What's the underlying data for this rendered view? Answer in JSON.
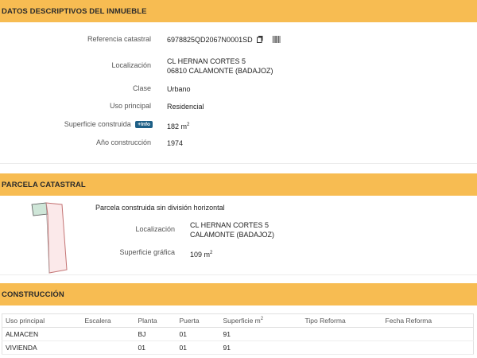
{
  "datos": {
    "title": "DATOS DESCRIPTIVOS DEL INMUEBLE",
    "ref_label": "Referencia catastral",
    "ref_value": "6978825QD2067N0001SD",
    "loc_label": "Localización",
    "loc_line1": "CL HERNAN CORTES 5",
    "loc_line2": "06810 CALAMONTE (BADAJOZ)",
    "clase_label": "Clase",
    "clase_value": "Urbano",
    "uso_label": "Uso principal",
    "uso_value": "Residencial",
    "sup_label": "Superficie construida",
    "info_badge": "+Info",
    "sup_value": "182 m",
    "sup_unit_exp": "2",
    "anio_label": "Año construcción",
    "anio_value": "1974"
  },
  "parcela": {
    "title": "PARCELA CATASTRAL",
    "desc": "Parcela construida sin división horizontal",
    "loc_label": "Localización",
    "loc_line1": "CL HERNAN CORTES 5",
    "loc_line2": "CALAMONTE (BADAJOZ)",
    "sup_label": "Superficie gráfica",
    "sup_value": "109 m",
    "sup_unit_exp": "2"
  },
  "construccion": {
    "title": "CONSTRUCCIÓN",
    "headers": [
      "Uso principal",
      "Escalera",
      "Planta",
      "Puerta",
      "Superficie m",
      "Tipo Reforma",
      "Fecha Reforma"
    ],
    "sup_header_exp": "2",
    "rows": [
      [
        "ALMACEN",
        "",
        "BJ",
        "01",
        "91",
        "",
        ""
      ],
      [
        "VIVIENDA",
        "",
        "01",
        "01",
        "91",
        "",
        ""
      ]
    ]
  },
  "colors": {
    "header_bg": "#f7bc52",
    "badge_bg": "#1d5f86",
    "parcel_fill": "#fbe9ea",
    "parcel_green": "#cfe6d8"
  },
  "icons": [
    "copy-icon",
    "barcode-icon"
  ]
}
